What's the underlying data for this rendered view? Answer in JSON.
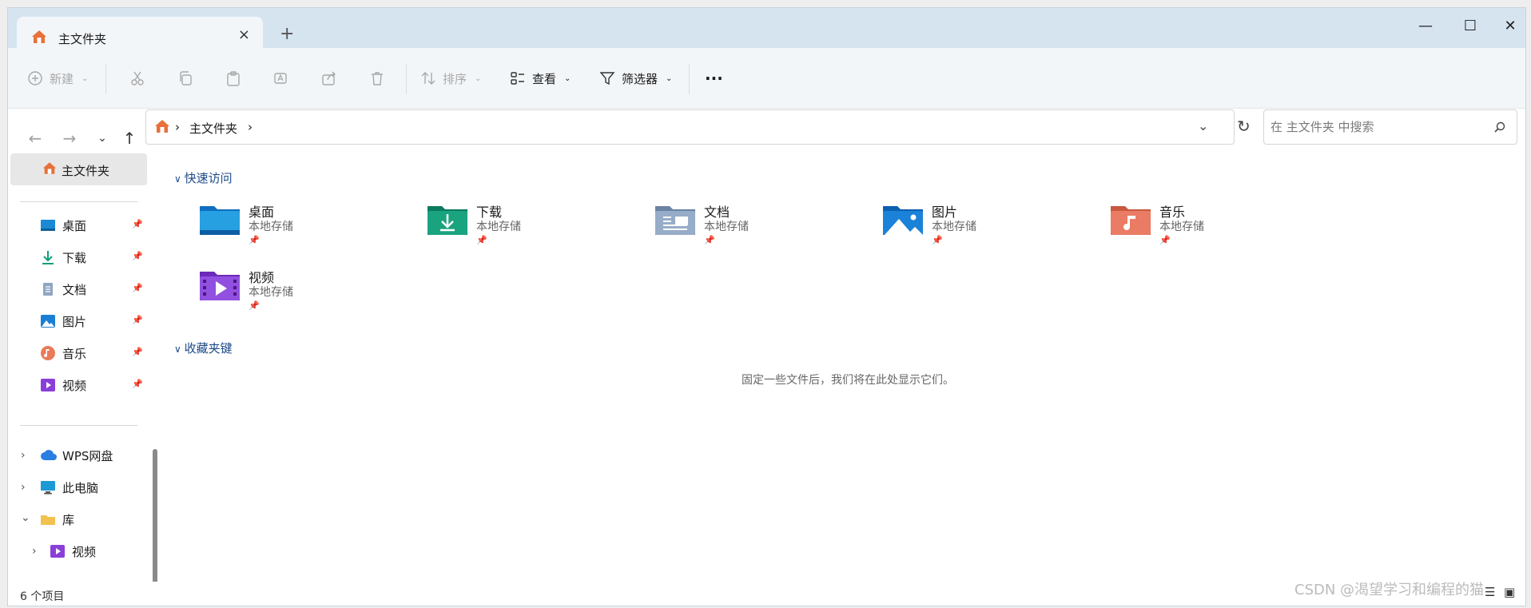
{
  "tab": {
    "title": "主文件夹",
    "close": "×",
    "new_tab": "+"
  },
  "window_controls": {
    "minimize": "—",
    "maximize": "☐",
    "close": "✕"
  },
  "toolbar": {
    "new_label": "新建",
    "sort_label": "排序",
    "view_label": "查看",
    "filter_label": "筛选器",
    "more": "···"
  },
  "address": {
    "crumb": "主文件夹",
    "sep1": "›",
    "sep2": "›"
  },
  "search": {
    "placeholder": "在 主文件夹 中搜索"
  },
  "sidebar": {
    "home": "主文件夹",
    "quick": [
      {
        "label": "桌面",
        "icon": "desktop-icon"
      },
      {
        "label": "下载",
        "icon": "download-icon"
      },
      {
        "label": "文档",
        "icon": "documents-icon"
      },
      {
        "label": "图片",
        "icon": "pictures-icon"
      },
      {
        "label": "音乐",
        "icon": "music-icon"
      },
      {
        "label": "视频",
        "icon": "videos-icon"
      }
    ],
    "tree": [
      {
        "label": "WPS网盘",
        "expander": "›"
      },
      {
        "label": "此电脑",
        "expander": "›"
      },
      {
        "label": "库",
        "expander": "⌄"
      },
      {
        "label": "视频",
        "expander": "›"
      }
    ]
  },
  "content": {
    "quick_access": "快速访问",
    "favorites": "收藏夹键",
    "favorites_empty": "固定一些文件后，我们将在此处显示它们。",
    "tiles": [
      {
        "name": "桌面",
        "sub": "本地存储"
      },
      {
        "name": "下载",
        "sub": "本地存储"
      },
      {
        "name": "文档",
        "sub": "本地存储"
      },
      {
        "name": "图片",
        "sub": "本地存储"
      },
      {
        "name": "音乐",
        "sub": "本地存储"
      },
      {
        "name": "视频",
        "sub": "本地存储"
      }
    ]
  },
  "status": {
    "count": "6 个项目"
  },
  "watermark": "CSDN @渴望学习和编程的猫",
  "colors": {
    "titlebar": "#d6e4f0",
    "accent": "#1b4a8a",
    "home_orange": "#e8703a"
  }
}
